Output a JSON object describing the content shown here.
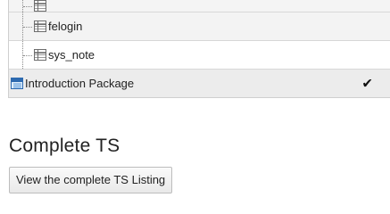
{
  "tree": {
    "items": [
      {
        "label": "",
        "icon": "table-icon"
      },
      {
        "label": "felogin",
        "icon": "table-icon"
      },
      {
        "label": "sys_note",
        "icon": "table-icon"
      }
    ],
    "package": {
      "label": "Introduction Package",
      "icon": "package-icon",
      "status_icon": "checkmark-icon",
      "status_glyph": "✔"
    }
  },
  "section": {
    "title": "Complete TS",
    "button_label": "View the complete TS Listing"
  }
}
